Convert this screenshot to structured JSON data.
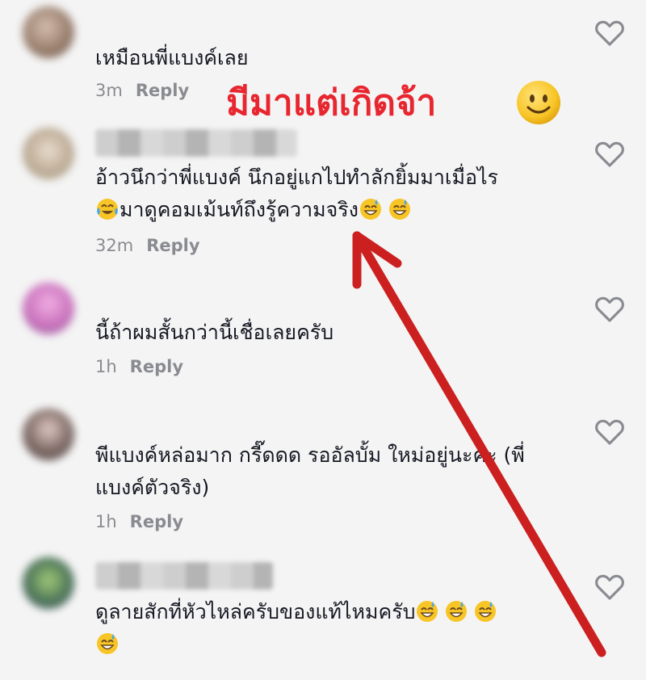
{
  "comments": [
    {
      "text": "เหมือนพี่แบงค์เลย",
      "time": "3m",
      "reply": "Reply",
      "avatar_color": "#8a6d5a"
    },
    {
      "text": "อ้าวนึกว่าพี่แบงค์ นึกอยู่แกไปทำลักยิ้มมาเมื่อไร",
      "text2": "มาดูคอมเม้นท์ถึงรู้ความจริง",
      "time": "32m",
      "reply": "Reply",
      "avatar_color": "#b9a58e"
    },
    {
      "text": "นี้ถ้าผมสั้นกว่านี้เชื่อเลยครับ",
      "time": "1h",
      "reply": "Reply",
      "avatar_color": "#c766b8"
    },
    {
      "text": "พีแบงค์หล่อมาก กรี๊ดดด รออัลบั้ม ใหม่อยู่นะคะ (พี่",
      "text2": "แบงค์ตัวจริง)",
      "time": "1h",
      "reply": "Reply",
      "avatar_color": "#6f5a55"
    },
    {
      "text": "ดูลายสักที่หัวไหล่ครับของแท้ไหมครับ",
      "time": "",
      "reply": "",
      "avatar_color": "#3d6a4a"
    }
  ],
  "overlay": {
    "label": "มีมาแต่เกิดจ้า",
    "color": "#e8262f"
  },
  "icons": {
    "like": "heart-outline-icon",
    "smile": "smiley-emoji-icon",
    "laugh": "tears-of-joy-emoji-icon",
    "sweat": "grinning-sweat-emoji-icon"
  }
}
